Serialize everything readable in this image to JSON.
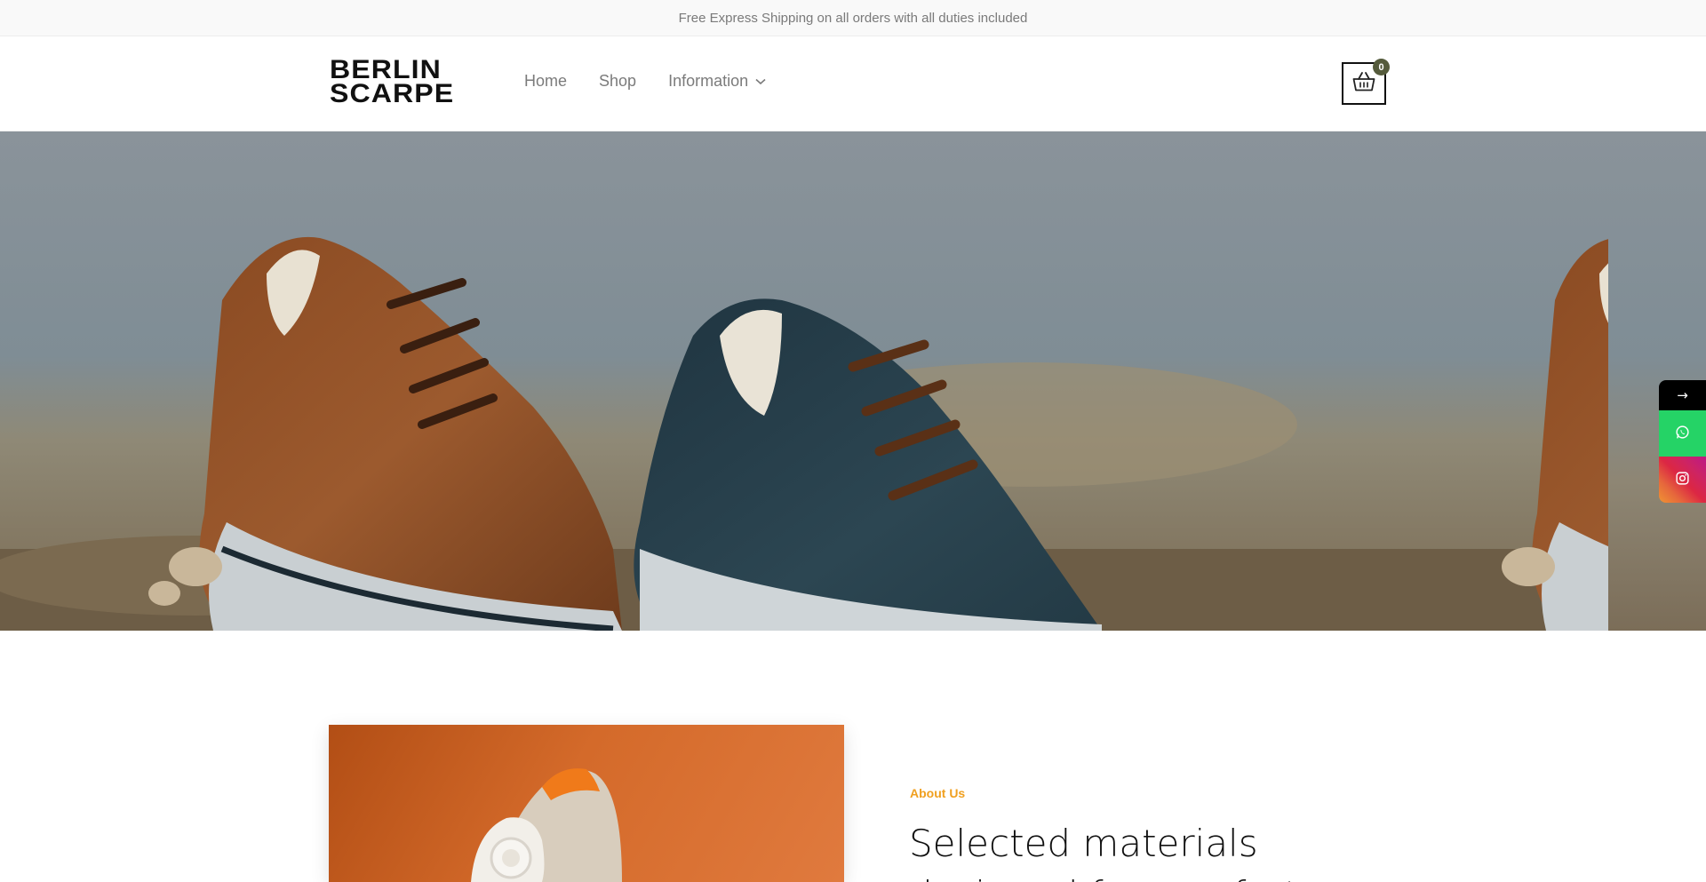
{
  "announcement": "Free Express Shipping on all orders with all duties included",
  "header": {
    "logo_line1": "BERLIN",
    "logo_line2": "SCARPE",
    "nav": [
      {
        "label": "Home"
      },
      {
        "label": "Shop"
      },
      {
        "label": "Information",
        "has_dropdown": true
      }
    ],
    "cart_count": "0",
    "cart_icon": "basket-icon"
  },
  "side_buttons": {
    "arrow": "→",
    "whatsapp_icon": "whatsapp-icon",
    "instagram_icon": "instagram-icon"
  },
  "about": {
    "label": "About Us",
    "heading_line1": "Selected materials",
    "heading_line2": "designed for comfort"
  },
  "colors": {
    "accent": "#f0a020",
    "cart_badge": "#555b3c",
    "whatsapp": "#25d366"
  }
}
